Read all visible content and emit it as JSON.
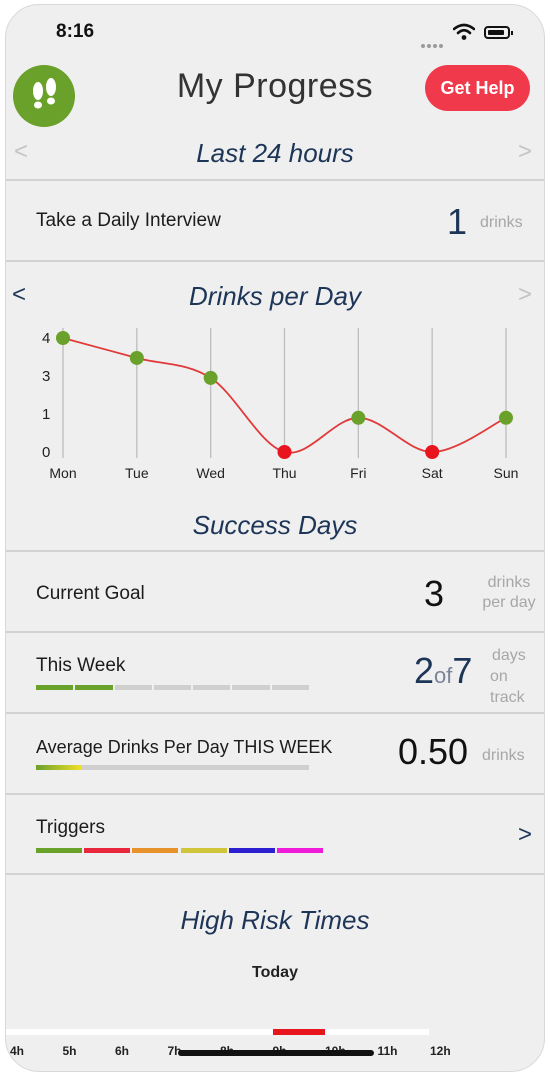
{
  "status_bar": {
    "time": "8:16"
  },
  "header": {
    "title": "My Progress",
    "help_label": "Get Help"
  },
  "last24": {
    "title": "Last 24 hours",
    "interview_label": "Take a Daily Interview",
    "drinks_value": "1",
    "drinks_unit": "drinks"
  },
  "chart_section": {
    "title": "Drinks per Day"
  },
  "chart_data": {
    "type": "line",
    "categories": [
      "Mon",
      "Tue",
      "Wed",
      "Thu",
      "Fri",
      "Sat",
      "Sun"
    ],
    "series": [
      {
        "values": [
          4,
          3.3,
          2.6,
          0,
          1.2,
          0,
          1.2
        ]
      }
    ],
    "ytick_labels": [
      "0",
      "1",
      "3",
      "4"
    ],
    "ylim": [
      0,
      4
    ],
    "point_status": [
      "ok",
      "ok",
      "ok",
      "zero",
      "ok",
      "zero",
      "ok"
    ],
    "colors": {
      "line": "#e03a3a",
      "ok_point": "#6aa12a",
      "zero_point": "#e8141e",
      "gridline": "#bdbdbd"
    }
  },
  "success": {
    "title": "Success Days",
    "goal_label": "Current Goal",
    "goal_value": "3",
    "goal_unit_1": "drinks",
    "goal_unit_2": "per day",
    "week_label": "This Week",
    "week_value": "2",
    "week_of": "of",
    "week_total": "7",
    "week_unit_1": "days",
    "week_unit_2": "on",
    "week_unit_3": "track",
    "week_progress": 0.286,
    "avg_label": "Average Drinks Per Day THIS WEEK",
    "avg_value": "0.50",
    "avg_unit": "drinks",
    "avg_progress": 0.17,
    "triggers_label": "Triggers"
  },
  "triggers_colors": [
    "#6aa12a",
    "#e8263c",
    "#e8922b",
    "#cfc43a",
    "#2b1fd1",
    "#f01bd8"
  ],
  "high_risk": {
    "title": "High Risk Times",
    "today_label": "Today",
    "hours": [
      "4h",
      "5h",
      "6h",
      "7h",
      "8h",
      "9h",
      "10h",
      "11h",
      "12h"
    ],
    "risk_window": [
      "9h",
      "10h"
    ],
    "risk_color": "#e8141e"
  }
}
